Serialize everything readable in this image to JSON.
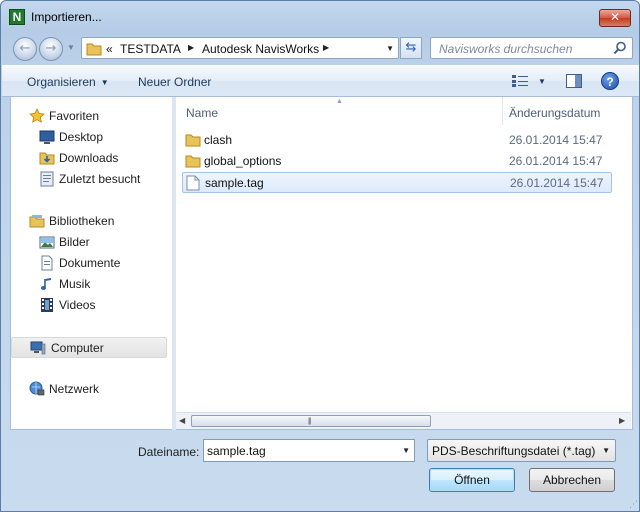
{
  "window": {
    "title": "Importieren...",
    "app_icon_letter": "N",
    "close_glyph": "✕"
  },
  "address_bar": {
    "overflow": "«",
    "crumbs": [
      "TESTDATA",
      "Autodesk NavisWorks"
    ],
    "search_placeholder": "Navisworks durchsuchen"
  },
  "toolbar": {
    "organize_label": "Organisieren",
    "new_folder_label": "Neuer Ordner",
    "help_glyph": "?"
  },
  "sidebar": {
    "favorites": {
      "label": "Favoriten",
      "icon": "star-icon",
      "items": [
        {
          "label": "Desktop",
          "icon": "desktop-icon"
        },
        {
          "label": "Downloads",
          "icon": "downloads-folder-icon"
        },
        {
          "label": "Zuletzt besucht",
          "icon": "recent-places-icon"
        }
      ]
    },
    "libraries": {
      "label": "Bibliotheken",
      "icon": "libraries-icon",
      "items": [
        {
          "label": "Bilder",
          "icon": "pictures-icon"
        },
        {
          "label": "Dokumente",
          "icon": "documents-icon"
        },
        {
          "label": "Musik",
          "icon": "music-icon"
        },
        {
          "label": "Videos",
          "icon": "videos-icon"
        }
      ]
    },
    "computer": {
      "label": "Computer",
      "icon": "computer-icon",
      "selected": true
    },
    "network": {
      "label": "Netzwerk",
      "icon": "network-icon"
    }
  },
  "file_list": {
    "columns": {
      "name": "Name",
      "date": "Änderungsdatum"
    },
    "rows": [
      {
        "name": "clash",
        "date": "26.01.2014 15:47",
        "type": "folder",
        "selected": false
      },
      {
        "name": "global_options",
        "date": "26.01.2014 15:47",
        "type": "folder",
        "selected": false
      },
      {
        "name": "sample.tag",
        "date": "26.01.2014 15:47",
        "type": "file",
        "selected": true
      }
    ]
  },
  "footer": {
    "filename_label": "Dateiname:",
    "filename_value": "sample.tag",
    "filetype_value": "PDS-Beschriftungsdatei (*.tag)",
    "open_label": "Öffnen",
    "cancel_label": "Abbrechen"
  },
  "colors": {
    "window_frame": "#bcd2ea",
    "selection": "#dceafb",
    "toolbar_text": "#1e395b"
  }
}
